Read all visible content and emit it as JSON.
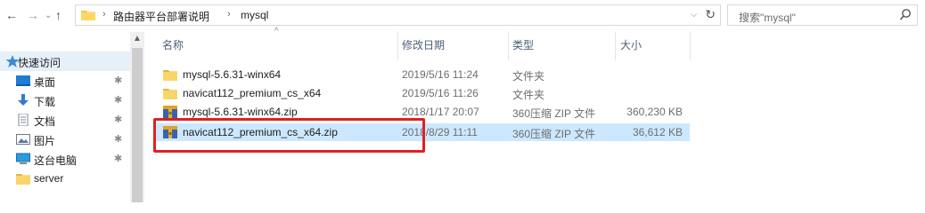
{
  "address": {
    "crumbs": [
      "路由器平台部署说明",
      "mysql"
    ]
  },
  "search": {
    "placeholder": "搜索\"mysql\""
  },
  "nav_pane": {
    "quick_access_label": "快速访问",
    "items": [
      {
        "label": "桌面",
        "icon": "desktop-icon"
      },
      {
        "label": "下载",
        "icon": "download-icon"
      },
      {
        "label": "文档",
        "icon": "documents-icon"
      },
      {
        "label": "图片",
        "icon": "pictures-icon"
      },
      {
        "label": "这台电脑",
        "icon": "this-pc-icon"
      },
      {
        "label": "server",
        "icon": "folder-icon"
      }
    ]
  },
  "columns": {
    "name": "名称",
    "modified": "修改日期",
    "type": "类型",
    "size": "大小"
  },
  "files": [
    {
      "name": "mysql-5.6.31-winx64",
      "modified": "2019/5/16 11:24",
      "type": "文件夹",
      "size": "",
      "icon": "folder-icon"
    },
    {
      "name": "navicat112_premium_cs_x64",
      "modified": "2019/5/16 11:26",
      "type": "文件夹",
      "size": "",
      "icon": "folder-icon"
    },
    {
      "name": "mysql-5.6.31-winx64.zip",
      "modified": "2018/1/17 20:07",
      "type": "360压缩 ZIP 文件",
      "size": "360,230 KB",
      "icon": "zip-archive-icon"
    },
    {
      "name": "navicat112_premium_cs_x64.zip",
      "modified": "2018/8/29 11:11",
      "type": "360压缩 ZIP 文件",
      "size": "36,612 KB",
      "icon": "zip-archive-icon"
    }
  ],
  "colors": {
    "selection": "#cce8ff",
    "highlight_box": "#e02020",
    "folder": "#f6c84a"
  }
}
